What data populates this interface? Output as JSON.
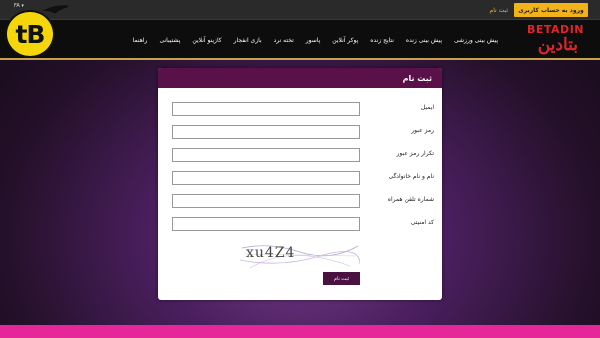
{
  "topbar": {
    "login_label": "ورود به حساب کاربری",
    "register_label": "ثبت نام",
    "lang_label": "FA ▾"
  },
  "logo": {
    "text": "tB"
  },
  "brand": {
    "en": "BETADIN",
    "fa": "بتادین"
  },
  "nav": {
    "items": [
      "پیش بینی ورزشی",
      "پیش بینی زنده",
      "نتایج زنده",
      "پوکر آنلاین",
      "پاسور",
      "تخته نرد",
      "بازی انفجار",
      "کازینو آنلاین",
      "پشتیبانی",
      "راهنما"
    ]
  },
  "form": {
    "title": "ثبت نام",
    "fields": [
      {
        "label": "ایمیل",
        "value": ""
      },
      {
        "label": "رمز عبور",
        "value": ""
      },
      {
        "label": "تکرار رمز عبور",
        "value": ""
      },
      {
        "label": "نام و نام خانوادگی",
        "value": ""
      },
      {
        "label": "شماره تلفن همراه",
        "value": ""
      },
      {
        "label": "کد امنیتی",
        "value": ""
      }
    ],
    "captcha_text": "xu4Z4",
    "submit_label": "ثبت نام"
  },
  "colors": {
    "accent_yellow": "#f2b21a",
    "header_purple": "#5a1149",
    "button_purple": "#4a1240",
    "bottom_pink": "#e6279a",
    "logo_yellow": "#f5d60a",
    "brand_red": "#e0242a"
  }
}
